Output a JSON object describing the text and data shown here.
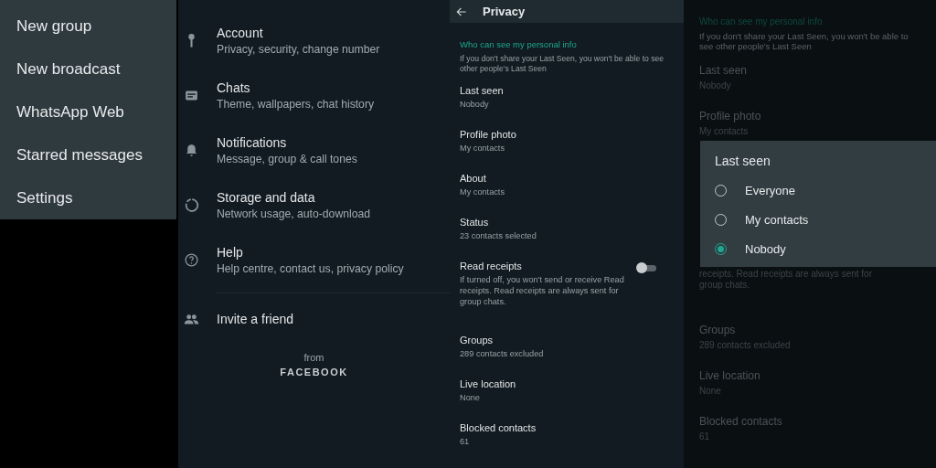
{
  "menu": {
    "items": [
      {
        "label": "New group"
      },
      {
        "label": "New broadcast"
      },
      {
        "label": "WhatsApp Web"
      },
      {
        "label": "Starred messages"
      },
      {
        "label": "Settings"
      }
    ]
  },
  "settings": {
    "items": [
      {
        "title": "Account",
        "subtitle": "Privacy, security, change number"
      },
      {
        "title": "Chats",
        "subtitle": "Theme, wallpapers, chat history"
      },
      {
        "title": "Notifications",
        "subtitle": "Message, group & call tones"
      },
      {
        "title": "Storage and data",
        "subtitle": "Network usage, auto-download"
      },
      {
        "title": "Help",
        "subtitle": "Help centre, contact us, privacy policy"
      }
    ],
    "invite": {
      "label": "Invite a friend"
    },
    "footer": {
      "from": "from",
      "brand": "FACEBOOK"
    }
  },
  "privacy": {
    "title": "Privacy",
    "section_header": "Who can see my personal info",
    "section_note": "If you don't share your Last Seen, you won't be able to see other people's Last Seen",
    "items": [
      {
        "kind": "setting",
        "title": "Last seen",
        "value": "Nobody"
      },
      {
        "kind": "setting",
        "title": "Profile photo",
        "value": "My contacts"
      },
      {
        "kind": "setting",
        "title": "About",
        "value": "My contacts"
      },
      {
        "kind": "setting",
        "title": "Status",
        "value": "23 contacts selected"
      },
      {
        "kind": "toggle",
        "title": "Read receipts",
        "note": "If turned off, you won't send or receive Read receipts. Read receipts are always sent for group chats.",
        "on": false
      },
      {
        "kind": "setting",
        "title": "Groups",
        "value": "289 contacts excluded"
      },
      {
        "kind": "setting",
        "title": "Live location",
        "value": "None"
      },
      {
        "kind": "setting",
        "title": "Blocked contacts",
        "value": "61"
      }
    ]
  },
  "privacy_dimmed": {
    "section_header": "Who can see my personal info",
    "section_note": "If you don't share your Last Seen, you won't be able to see other people's Last Seen",
    "items_top": [
      {
        "title": "Last seen",
        "value": "Nobody"
      },
      {
        "title": "Profile photo",
        "value": "My contacts"
      }
    ],
    "read_receipts_note_tail": "receipts. Read receipts are always sent for group chats.",
    "items_bottom": [
      {
        "title": "Groups",
        "value": "289 contacts excluded"
      },
      {
        "title": "Live location",
        "value": "None"
      },
      {
        "title": "Blocked contacts",
        "value": "61"
      }
    ]
  },
  "dialog": {
    "title": "Last seen",
    "options": [
      {
        "label": "Everyone",
        "selected": false
      },
      {
        "label": "My contacts",
        "selected": false
      },
      {
        "label": "Nobody",
        "selected": true
      }
    ]
  }
}
